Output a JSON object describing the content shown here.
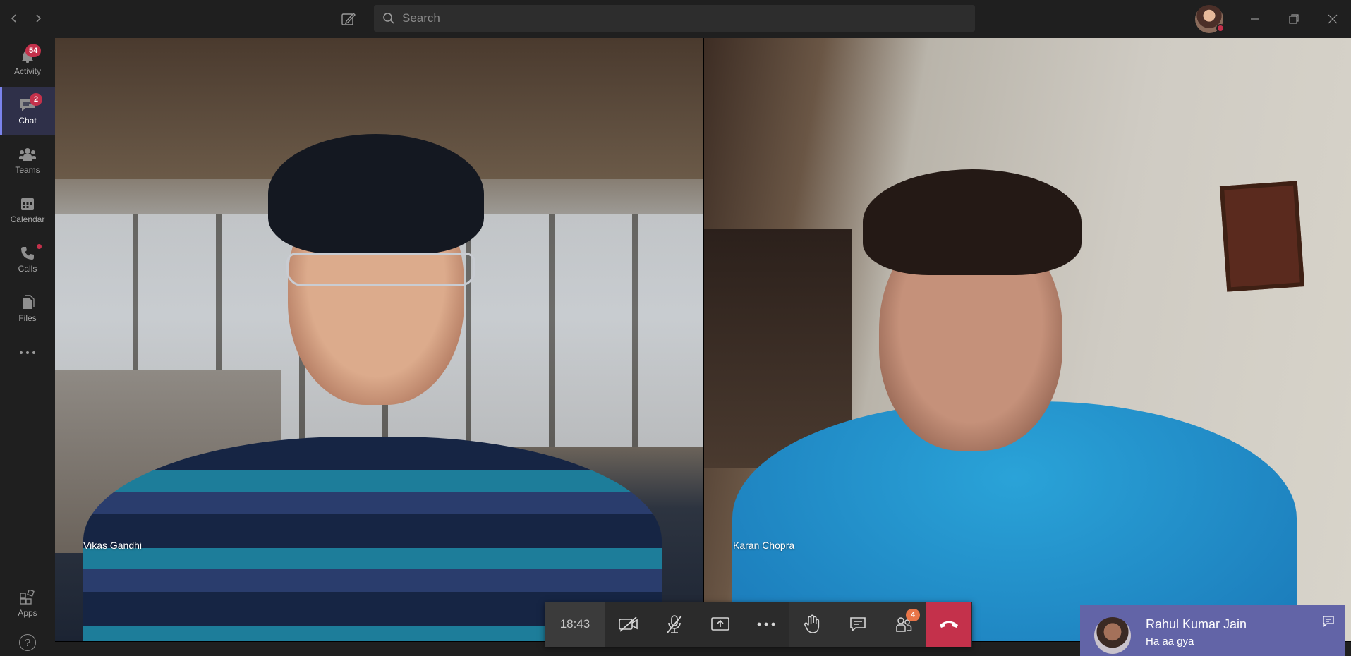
{
  "titlebar": {
    "search_placeholder": "Search"
  },
  "rail": {
    "items": [
      {
        "label": "Activity",
        "icon": "bell-icon",
        "badge": "54"
      },
      {
        "label": "Chat",
        "icon": "chat-icon",
        "badge": "2",
        "active": true
      },
      {
        "label": "Teams",
        "icon": "teams-icon"
      },
      {
        "label": "Calendar",
        "icon": "calendar-icon"
      },
      {
        "label": "Calls",
        "icon": "phone-icon",
        "dot": true
      },
      {
        "label": "Files",
        "icon": "files-icon"
      }
    ],
    "more_icon": "more-dots-icon",
    "apps_label": "Apps",
    "help_label": "?"
  },
  "call": {
    "participants": [
      {
        "name": "Vikas Gandhi"
      },
      {
        "name": "Karan Chopra"
      }
    ],
    "timer": "18:43",
    "participants_badge": "4",
    "colors": {
      "hangup": "#c4314b",
      "badge": "#e97548"
    }
  },
  "toast": {
    "sender": "Rahul Kumar Jain",
    "message": "Ha aa gya",
    "accent": "#6264a7"
  }
}
